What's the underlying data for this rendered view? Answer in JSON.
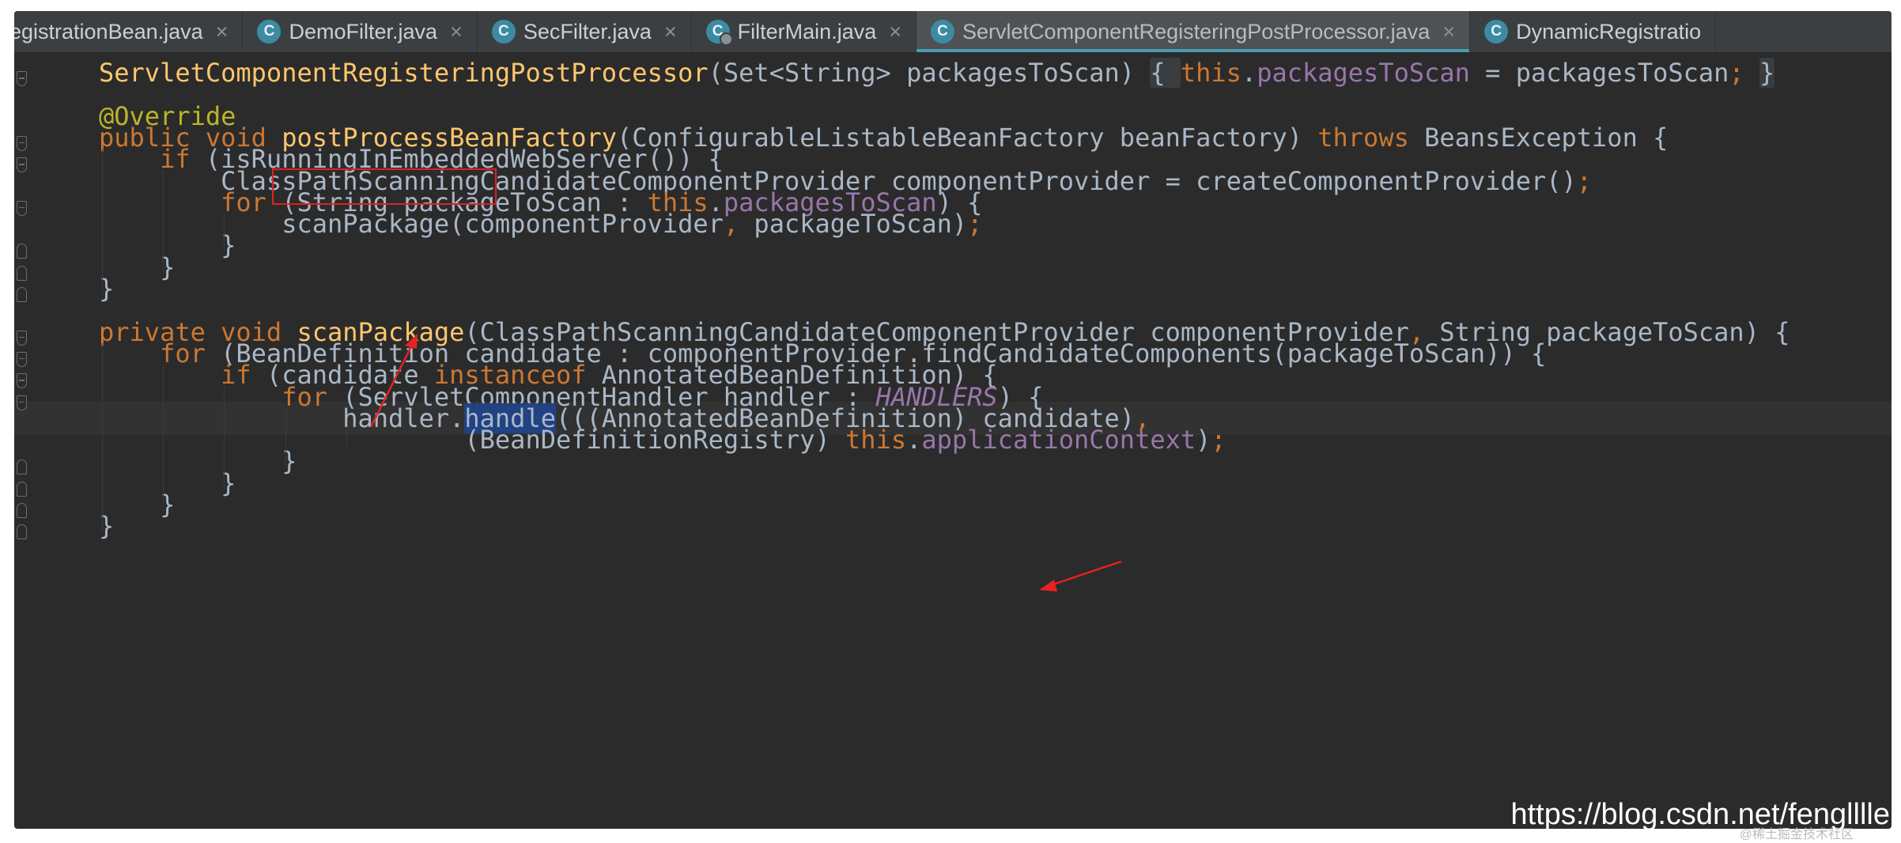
{
  "tabs": [
    {
      "label": "egistrationBean.java",
      "icon": "",
      "active": false
    },
    {
      "label": "DemoFilter.java",
      "icon": "C",
      "active": false
    },
    {
      "label": "SecFilter.java",
      "icon": "C",
      "active": false
    },
    {
      "label": "FilterMain.java",
      "icon": "C",
      "active": false
    },
    {
      "label": "ServletComponentRegisteringPostProcessor.java",
      "icon": "C",
      "active": true
    },
    {
      "label": "DynamicRegistratio",
      "icon": "C",
      "active": false
    }
  ],
  "tab_close_glyph": "×",
  "code_lines": [
    [
      [
        "fn",
        "ServletComponentRegisteringPostProcessor"
      ],
      [
        "pl",
        "(Set<String> packagesToScan) "
      ],
      [
        "fold-brace",
        "{ "
      ],
      [
        "kw",
        "this"
      ],
      [
        "pl",
        "."
      ],
      [
        "fld",
        "packagesToScan"
      ],
      [
        "pl",
        " = packagesToScan"
      ],
      [
        "kw",
        ";"
      ],
      [
        "pl",
        " "
      ],
      [
        "fold-brace",
        "}"
      ]
    ],
    [],
    [
      [
        "ann",
        "@Override"
      ]
    ],
    [
      [
        "kw",
        "public void "
      ],
      [
        "fn",
        "postProcessBeanFactory"
      ],
      [
        "pl",
        "(ConfigurableListableBeanFactory beanFactory) "
      ],
      [
        "kw",
        "throws "
      ],
      [
        "pl",
        "BeansException {"
      ]
    ],
    [
      [
        "pl",
        "    "
      ],
      [
        "kw",
        "if "
      ],
      [
        "pl",
        "(isRunningInEmbeddedWebServer()) {"
      ]
    ],
    [
      [
        "pl",
        "        ClassPathScanningCandidateComponentProvider componentProvider = createComponentProvider()"
      ],
      [
        "kw",
        ";"
      ]
    ],
    [
      [
        "pl",
        "        "
      ],
      [
        "kw",
        "for "
      ],
      [
        "pl",
        "(String packageToScan : "
      ],
      [
        "kw",
        "this"
      ],
      [
        "pl",
        "."
      ],
      [
        "fld",
        "packagesToScan"
      ],
      [
        "pl",
        ") {"
      ]
    ],
    [
      [
        "pl",
        "            scanPackage(componentProvider"
      ],
      [
        "kw",
        ", "
      ],
      [
        "pl",
        "packageToScan)"
      ],
      [
        "kw",
        ";"
      ]
    ],
    [
      [
        "pl",
        "        }"
      ]
    ],
    [
      [
        "pl",
        "    }"
      ]
    ],
    [
      [
        "pl",
        "}"
      ]
    ],
    [],
    [
      [
        "kw",
        "private void "
      ],
      [
        "fn",
        "scanPackage"
      ],
      [
        "pl",
        "(ClassPathScanningCandidateComponentProvider componentProvider"
      ],
      [
        "kw",
        ", "
      ],
      [
        "pl",
        "String packageToScan) {"
      ]
    ],
    [
      [
        "pl",
        "    "
      ],
      [
        "kw",
        "for "
      ],
      [
        "pl",
        "(BeanDefinition candidate : componentProvider.findCandidateComponents(packageToScan)) {"
      ]
    ],
    [
      [
        "pl",
        "        "
      ],
      [
        "kw",
        "if "
      ],
      [
        "pl",
        "(candidate "
      ],
      [
        "kw",
        "instanceof "
      ],
      [
        "pl",
        "AnnotatedBeanDefinition) {"
      ]
    ],
    [
      [
        "pl",
        "            "
      ],
      [
        "kw",
        "for "
      ],
      [
        "pl",
        "(ServletComponentHandler handler : "
      ],
      [
        "cst",
        "HANDLERS"
      ],
      [
        "pl",
        ") {"
      ]
    ],
    [
      [
        "pl",
        "                handler."
      ],
      [
        "sel-word",
        "handle"
      ],
      [
        "pl",
        "(((AnnotatedBeanDefinition) candidate)"
      ],
      [
        "kw",
        ","
      ]
    ],
    [
      [
        "pl",
        "                        (BeanDefinitionRegistry) "
      ],
      [
        "kw",
        "this"
      ],
      [
        "pl",
        "."
      ],
      [
        "fld",
        "applicationContext"
      ],
      [
        "pl",
        ")"
      ],
      [
        "kw",
        ";"
      ]
    ],
    [
      [
        "pl",
        "            }"
      ]
    ],
    [
      [
        "pl",
        "        }"
      ]
    ],
    [
      [
        "pl",
        "    }"
      ]
    ],
    [
      [
        "pl",
        "}"
      ]
    ]
  ],
  "highlighted_method": "postProcessBeanFactory",
  "watermark": "https://blog.csdn.net/fenglllle",
  "watermark_small": "@稀土掘金技术社区"
}
